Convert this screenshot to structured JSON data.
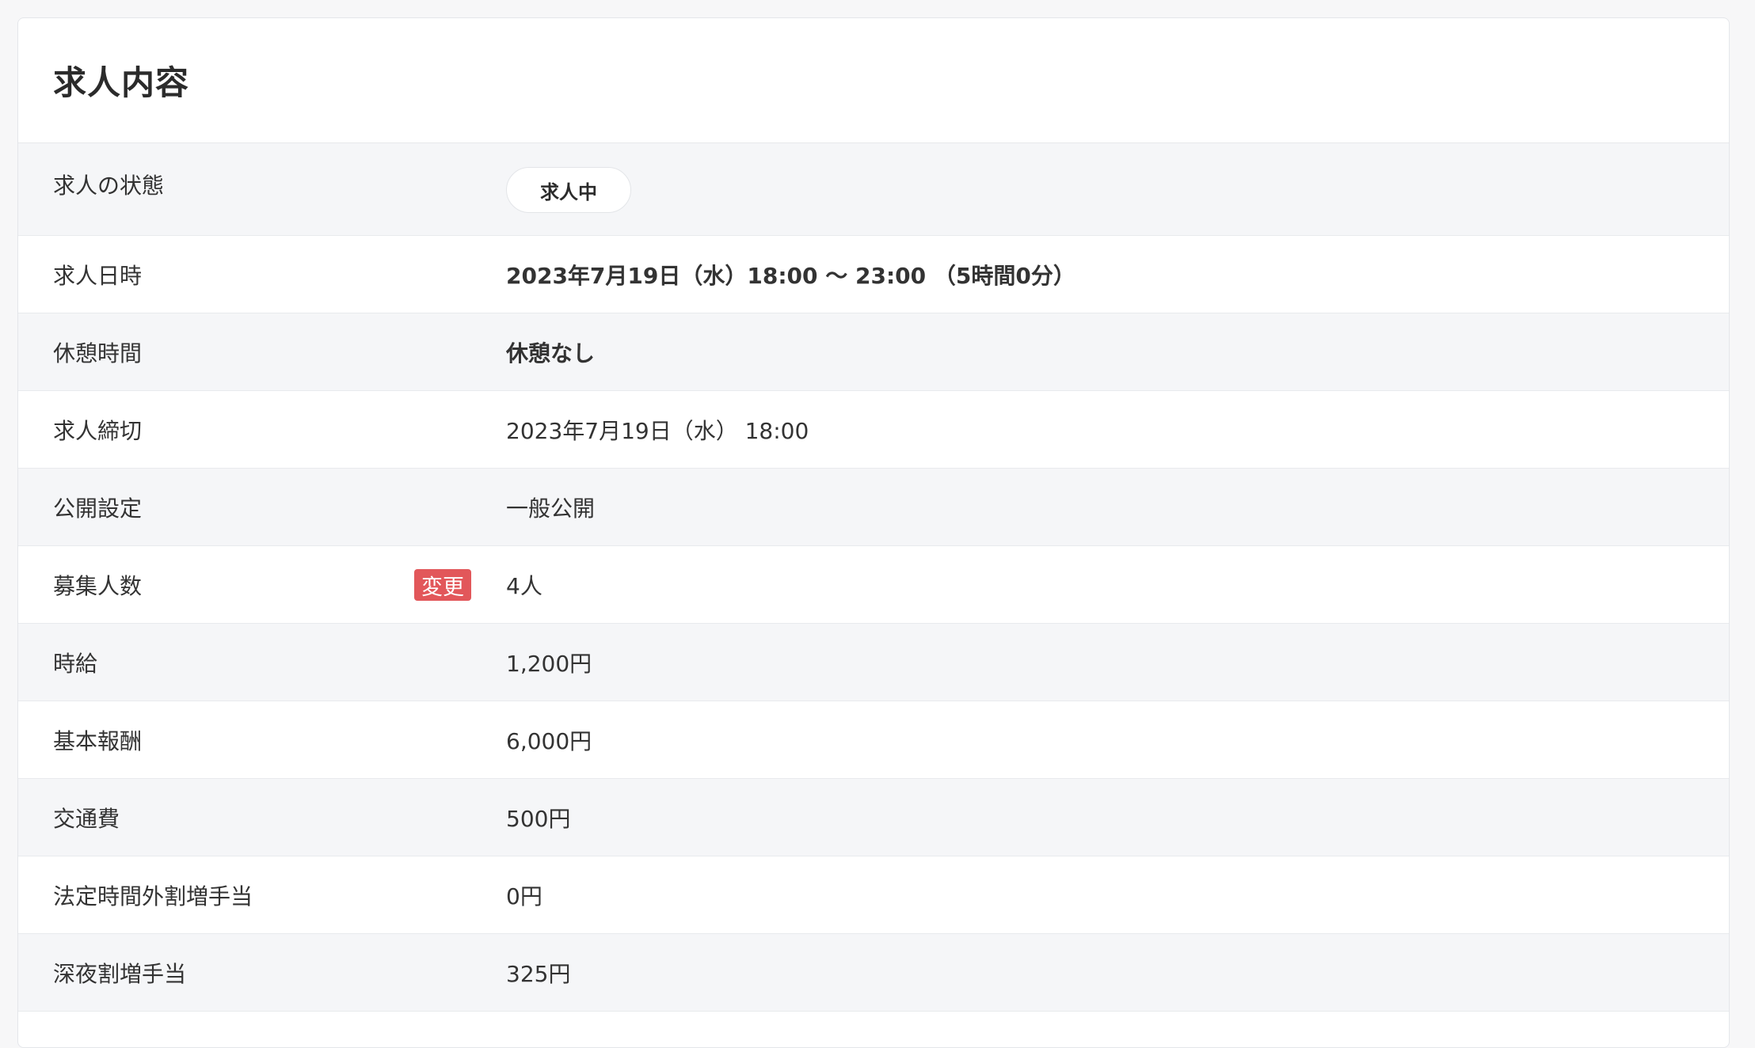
{
  "section": {
    "title": "求人内容"
  },
  "rows": [
    {
      "label": "求人の状態",
      "status": "求人中"
    },
    {
      "label": "求人日時",
      "value": "2023年7月19日（水）18:00 〜 23:00 （5時間0分）"
    },
    {
      "label": "休憩時間",
      "value": "休憩なし"
    },
    {
      "label": "求人締切",
      "value": "2023年7月19日（水） 18:00"
    },
    {
      "label": "公開設定",
      "value": "一般公開"
    },
    {
      "label": "募集人数",
      "badge": "変更",
      "value": "4人"
    },
    {
      "label": "時給",
      "value": "1,200円"
    },
    {
      "label": "基本報酬",
      "value": "6,000円"
    },
    {
      "label": "交通費",
      "value": "500円"
    },
    {
      "label": "法定時間外割増手当",
      "value": "0円"
    },
    {
      "label": "深夜割増手当",
      "value": "325円"
    }
  ],
  "colors": {
    "badge": "#e2575a",
    "alt_row": "#f5f6f8"
  }
}
